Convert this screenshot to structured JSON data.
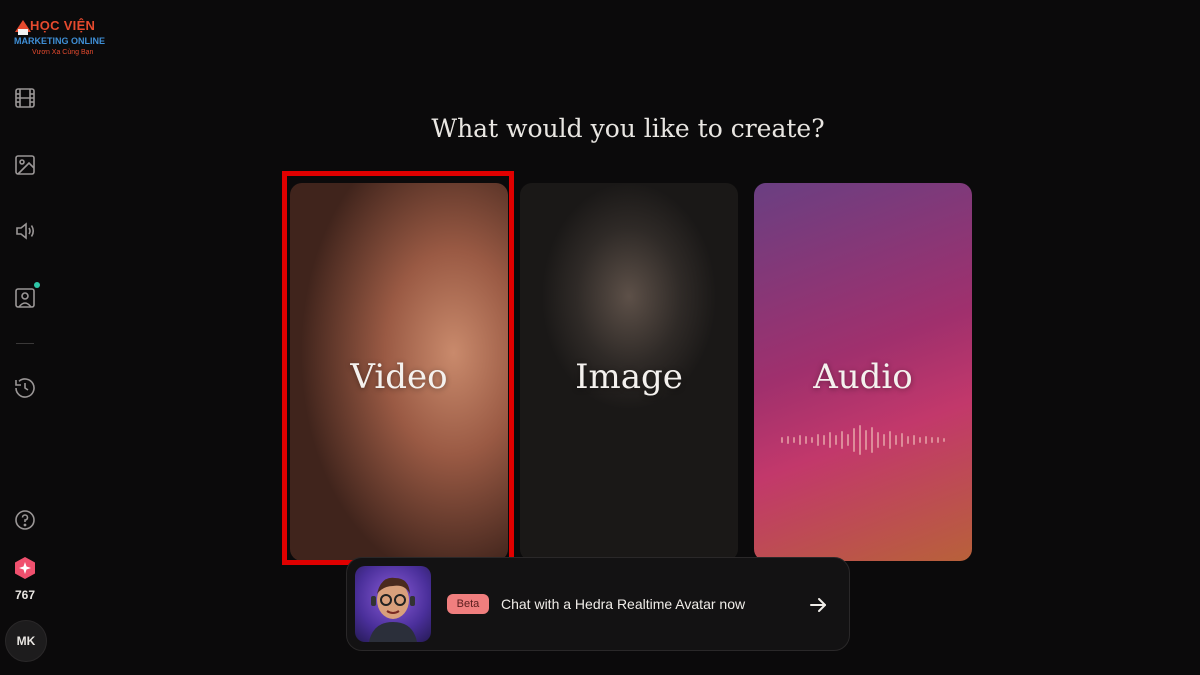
{
  "logo": {
    "line1": "HỌC VIỆN",
    "line2": "MARKETING ONLINE",
    "line3": "Vươn Xa Cùng Bạn"
  },
  "sidebar": {
    "items": [
      {
        "name": "video-icon"
      },
      {
        "name": "image-icon"
      },
      {
        "name": "audio-icon"
      },
      {
        "name": "avatar-portrait-icon"
      },
      {
        "name": "history-icon"
      }
    ],
    "help_icon": "help-icon",
    "credits_icon": "credits-icon",
    "credits": "767",
    "user_initials": "MK"
  },
  "main": {
    "heading": "What would you like to create?",
    "cards": [
      {
        "label": "Video",
        "selected": true
      },
      {
        "label": "Image",
        "selected": false
      },
      {
        "label": "Audio",
        "selected": false
      }
    ]
  },
  "chat_banner": {
    "badge": "Beta",
    "text": "Chat with a Hedra Realtime Avatar now",
    "icon": "arrow-right-icon"
  },
  "colors": {
    "background": "#0b0a0b",
    "selection": "#e00000",
    "beta_badge": "#f07e7e",
    "notification_dot": "#2fc7a8"
  }
}
